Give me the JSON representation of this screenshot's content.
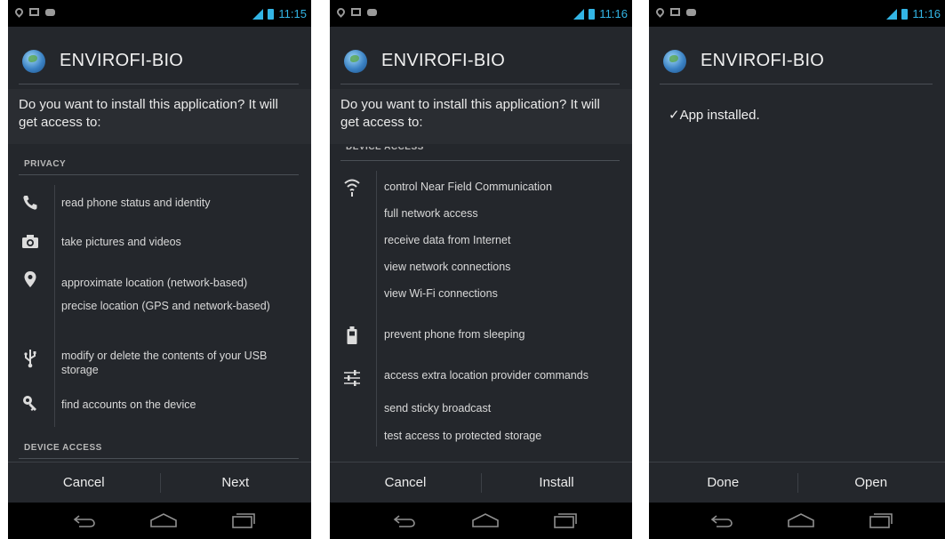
{
  "status_bar": {
    "time_1": "11:15",
    "time_2": "11:16",
    "time_3": "11:16"
  },
  "app": {
    "name": "ENVIROFI-BIO",
    "icon": "globe-icon"
  },
  "install_prompt": "Do you want to install this application? It will get access to:",
  "screen1": {
    "privacy_header": "PRIVACY",
    "permissions": [
      {
        "icon": "phone-icon",
        "text": "read phone status and identity"
      },
      {
        "icon": "camera-icon",
        "text": "take pictures and videos"
      },
      {
        "icon": "location-pin-icon",
        "text": "approximate location (network-based)"
      },
      {
        "icon": "",
        "text": "precise location (GPS and network-based)"
      },
      {
        "icon": "usb-icon",
        "text": "modify or delete the contents of your USB storage"
      },
      {
        "icon": "key-icon",
        "text": "find accounts on the device"
      }
    ],
    "device_access_header": "DEVICE ACCESS",
    "cancel_label": "Cancel",
    "next_label": "Next"
  },
  "screen2": {
    "device_access_header": "DEVICE ACCESS",
    "permissions": [
      {
        "icon": "wifi-icon",
        "text": "control Near Field Communication"
      },
      {
        "icon": "",
        "text": "full network access"
      },
      {
        "icon": "",
        "text": "receive data from Internet"
      },
      {
        "icon": "",
        "text": "view network connections"
      },
      {
        "icon": "",
        "text": "view Wi-Fi connections"
      },
      {
        "icon": "battery-icon",
        "text": "prevent phone from sleeping"
      },
      {
        "icon": "settings-sliders-icon",
        "text": "access extra location provider commands"
      },
      {
        "icon": "",
        "text": "send sticky broadcast"
      },
      {
        "icon": "",
        "text": "test access to protected storage"
      }
    ],
    "cancel_label": "Cancel",
    "install_label": "Install"
  },
  "screen3": {
    "installed_text": "✓App installed.",
    "done_label": "Done",
    "open_label": "Open"
  },
  "colors": {
    "background": "#24272c",
    "accent": "#33b5e5",
    "bars": "#000000"
  }
}
